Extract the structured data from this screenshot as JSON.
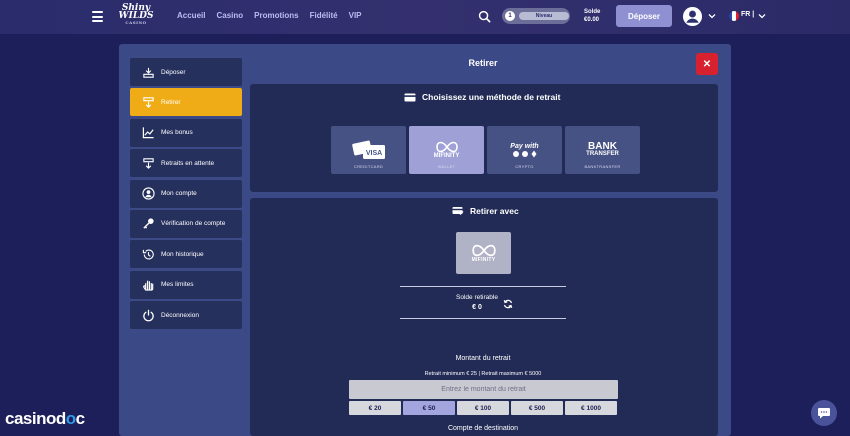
{
  "header": {
    "logo_line1": "Shiny",
    "logo_line2": "WILDS",
    "logo_sub": "CASINO",
    "nav": [
      "Accueil",
      "Casino",
      "Promotions",
      "Fidélité",
      "VIP"
    ],
    "level_number": "1",
    "level_label": "Niveau",
    "balance_label": "Solde",
    "balance_value": "€0.00",
    "deposit_label": "Déposer",
    "language": "FR |"
  },
  "modal": {
    "title": "Retirer",
    "close_symbol": "✕"
  },
  "sidebar": {
    "items": [
      {
        "label": "Déposer",
        "icon": "deposit-icon"
      },
      {
        "label": "Retirer",
        "icon": "withdraw-icon",
        "active": true
      },
      {
        "label": "Mes bonus",
        "icon": "chart-icon"
      },
      {
        "label": "Retraits en attente",
        "icon": "pending-withdraw-icon"
      },
      {
        "label": "Mon compte",
        "icon": "user-icon"
      },
      {
        "label": "Vérification de compte",
        "icon": "key-icon"
      },
      {
        "label": "Mon historique",
        "icon": "history-icon"
      },
      {
        "label": "Mes limites",
        "icon": "hand-icon"
      },
      {
        "label": "Déconnexion",
        "icon": "power-icon"
      }
    ]
  },
  "method_panel": {
    "title": "Choisissez une méthode de retrait",
    "methods": [
      {
        "name": "VISA",
        "sub": "CREDITCARD"
      },
      {
        "name": "MIFINITY",
        "sub": "WALLET",
        "selected": true
      },
      {
        "name": "Pay with",
        "sub": "CRYPTO"
      },
      {
        "name": "BANK",
        "name2": "TRANSFER",
        "sub": "BANKTRANSFER"
      }
    ]
  },
  "withdraw_panel": {
    "title": "Retirer avec",
    "selected_method": "MIFINITY",
    "withdrawable_label": "Solde retirable",
    "withdrawable_value": "€ 0",
    "amount_label": "Montant du retrait",
    "limits": "Retrait minimum € 25 | Retrait maximum € 5000",
    "amount_placeholder": "Entrez le montant du retrait",
    "presets": [
      "€ 20",
      "€ 50",
      "€ 100",
      "€ 500",
      "€ 1000"
    ],
    "selected_preset": "€ 50",
    "destination_label": "Compte de destination"
  },
  "watermark": {
    "part1": "casino",
    "part2": "d",
    "part3": "c"
  },
  "colors": {
    "accent": "#f0ac17",
    "close": "#d8212e",
    "deposit_button": "#8f90d2",
    "modal_bg": "#3c4987",
    "panel_bg": "#212b55"
  }
}
